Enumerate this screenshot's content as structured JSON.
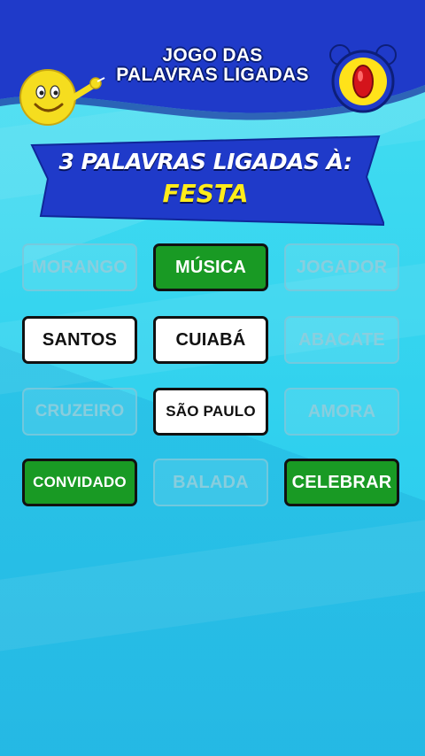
{
  "game": {
    "title_line1": "JOGO DAS",
    "title_line2": "PALAVRAS LIGADAS"
  },
  "banner": {
    "prompt": "3 PALAVRAS LIGADAS À:",
    "keyword": "FESTA"
  },
  "colors": {
    "header_blue": "#1f3ac9",
    "background_cyan": "#35d6ee",
    "selected_green": "#199a24",
    "keyword_yellow": "#ffec1a"
  },
  "icons": {
    "mascot": "smiley-pointing-emoji-icon",
    "timer": "alarm-clock-icon"
  },
  "tiles": [
    {
      "label": "MORANGO",
      "state": "faded"
    },
    {
      "label": "MÚSICA",
      "state": "correct"
    },
    {
      "label": "JOGADOR",
      "state": "faded"
    },
    {
      "label": "SANTOS",
      "state": "available"
    },
    {
      "label": "CUIABÁ",
      "state": "available"
    },
    {
      "label": "ABACATE",
      "state": "faded"
    },
    {
      "label": "CRUZEIRO",
      "state": "faded"
    },
    {
      "label": "SÃO PAULO",
      "state": "available"
    },
    {
      "label": "AMORA",
      "state": "faded"
    },
    {
      "label": "CONVIDADO",
      "state": "correct"
    },
    {
      "label": "BALADA",
      "state": "faded"
    },
    {
      "label": "CELEBRAR",
      "state": "correct"
    }
  ]
}
